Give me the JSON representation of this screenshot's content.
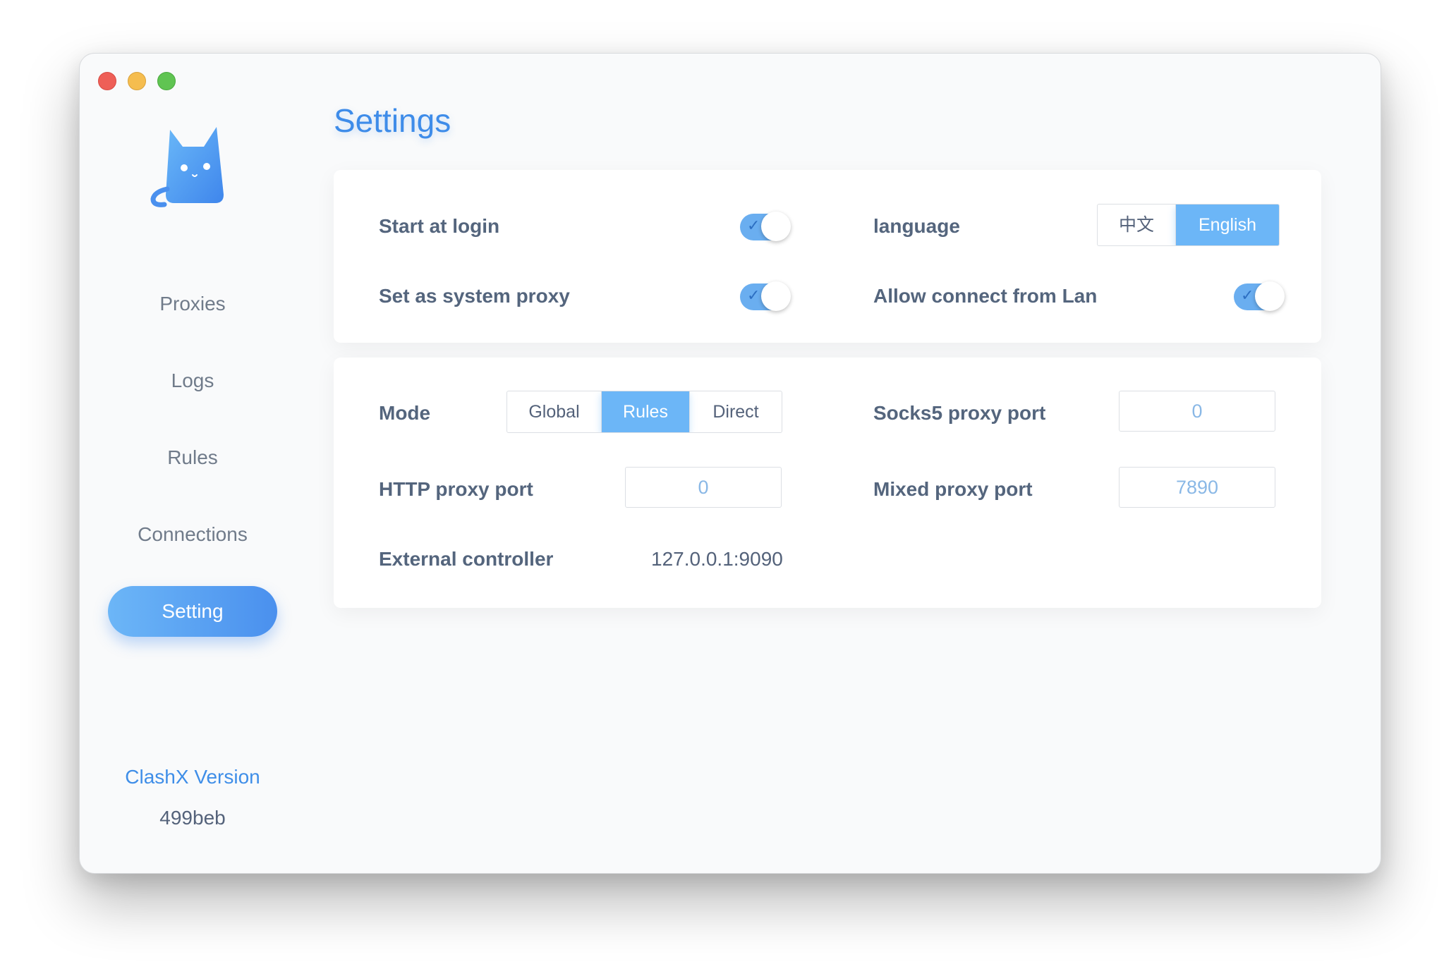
{
  "sidebar": {
    "logo_icon": "cat-logo",
    "items": [
      {
        "label": "Proxies"
      },
      {
        "label": "Logs"
      },
      {
        "label": "Rules"
      },
      {
        "label": "Connections"
      },
      {
        "label": "Setting",
        "active": true
      }
    ],
    "version_label": "ClashX Version",
    "version_value": "499beb"
  },
  "main": {
    "title": "Settings",
    "general": {
      "start_at_login": {
        "label": "Start at login",
        "on": true
      },
      "system_proxy": {
        "label": "Set as system proxy",
        "on": true
      },
      "language": {
        "label": "language",
        "options": [
          "中文",
          "English"
        ],
        "selected": "English"
      },
      "allow_lan": {
        "label": "Allow connect from Lan",
        "on": true
      }
    },
    "proxy": {
      "mode": {
        "label": "Mode",
        "options": [
          "Global",
          "Rules",
          "Direct"
        ],
        "selected": "Rules"
      },
      "socks5": {
        "label": "Socks5 proxy port",
        "value": "0"
      },
      "http": {
        "label": "HTTP proxy port",
        "value": "0"
      },
      "mixed": {
        "label": "Mixed proxy port",
        "value": "7890"
      },
      "external": {
        "label": "External controller",
        "value": "127.0.0.1:9090"
      }
    }
  },
  "colors": {
    "accent": "#3e8ce9",
    "toggle_on": "#6aaef0",
    "selected_segment": "#6cb6f7",
    "label_text": "#54657d"
  }
}
